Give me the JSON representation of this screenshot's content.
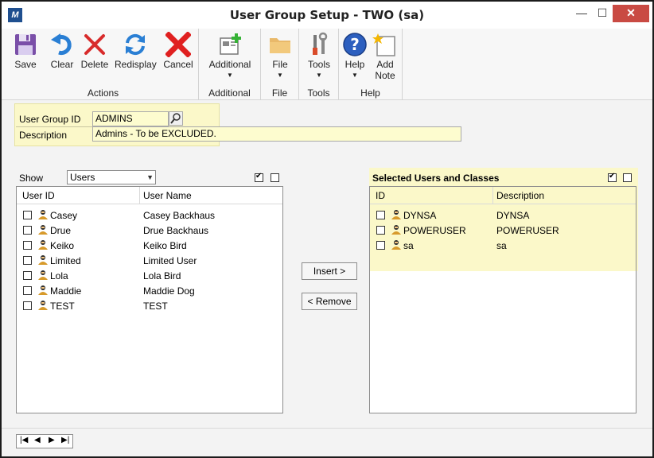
{
  "window": {
    "title": "User Group Setup  -  TWO (sa)"
  },
  "titlebar": {
    "minimize": "—",
    "maximize": "☐",
    "close": "✕",
    "app_icon": "M"
  },
  "ribbon": {
    "groups": [
      {
        "label": "Actions"
      },
      {
        "label": "Additional"
      },
      {
        "label": "File"
      },
      {
        "label": "Tools"
      },
      {
        "label": "Help"
      }
    ],
    "buttons": {
      "save": "Save",
      "clear": "Clear",
      "delete": "Delete",
      "redisplay": "Redisplay",
      "cancel": "Cancel",
      "additional": "Additional",
      "file": "File",
      "tools": "Tools",
      "help": "Help",
      "add_note_1": "Add",
      "add_note_2": "Note"
    }
  },
  "form": {
    "user_group_id_label": "User Group ID",
    "user_group_id_value": "ADMINS",
    "description_label": "Description",
    "description_value": "Admins - To be EXCLUDED."
  },
  "show": {
    "label": "Show",
    "selected": "Users"
  },
  "available_list": {
    "columns": [
      "User ID",
      "User Name"
    ],
    "rows": [
      {
        "id": "Casey",
        "name": "Casey Backhaus"
      },
      {
        "id": "Drue",
        "name": "Drue Backhaus"
      },
      {
        "id": "Keiko",
        "name": "Keiko Bird"
      },
      {
        "id": "Limited",
        "name": "Limited User"
      },
      {
        "id": "Lola",
        "name": "Lola Bird"
      },
      {
        "id": "Maddie",
        "name": "Maddie Dog"
      },
      {
        "id": "TEST",
        "name": "TEST"
      }
    ]
  },
  "actions": {
    "insert": "Insert >",
    "remove": "< Remove"
  },
  "selected_list": {
    "title": "Selected Users and Classes",
    "columns": [
      "ID",
      "Description"
    ],
    "rows": [
      {
        "id": "DYNSA",
        "desc": "DYNSA"
      },
      {
        "id": "POWERUSER",
        "desc": "POWERUSER"
      },
      {
        "id": "sa",
        "desc": "sa"
      }
    ]
  },
  "navigation": {
    "first": "|◀",
    "prev": "◀",
    "next": "▶",
    "last": "▶|"
  },
  "colors": {
    "highlight": "#fbf8c9",
    "close_button": "#c94a43",
    "accent_blue": "#1f5fb8"
  }
}
